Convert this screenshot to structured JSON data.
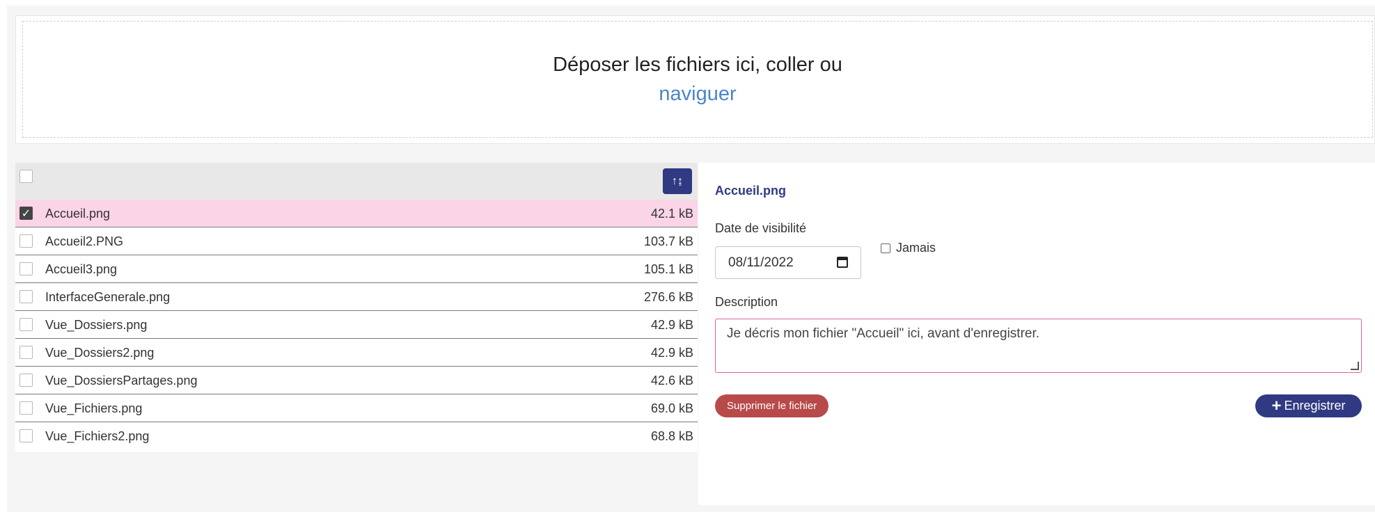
{
  "dropzone": {
    "text": "Déposer les fichiers ici, coller ou",
    "browse_link": "naviguer"
  },
  "file_list": {
    "sort_icon": "sort-ascending-icon",
    "files": [
      {
        "name": "Accueil.png",
        "size": "42.1 kB",
        "checked": true
      },
      {
        "name": "Accueil2.PNG",
        "size": "103.7 kB",
        "checked": false
      },
      {
        "name": "Accueil3.png",
        "size": "105.1 kB",
        "checked": false
      },
      {
        "name": "InterfaceGenerale.png",
        "size": "276.6 kB",
        "checked": false
      },
      {
        "name": "Vue_Dossiers.png",
        "size": "42.9 kB",
        "checked": false
      },
      {
        "name": "Vue_Dossiers2.png",
        "size": "42.9 kB",
        "checked": false
      },
      {
        "name": "Vue_DossiersPartages.png",
        "size": "42.6 kB",
        "checked": false
      },
      {
        "name": "Vue_Fichiers.png",
        "size": "69.0 kB",
        "checked": false
      },
      {
        "name": "Vue_Fichiers2.png",
        "size": "68.8 kB",
        "checked": false
      }
    ]
  },
  "details": {
    "title": "Accueil.png",
    "visibility_label": "Date de visibilité",
    "visibility_date": "08/11/2022",
    "never_label": "Jamais",
    "description_label": "Description",
    "description_value": "Je décris mon fichier \"Accueil\" ici, avant d'enregistrer.",
    "delete_label": "Supprimer le fichier",
    "save_label": "Enregistrer"
  },
  "colors": {
    "primary": "#303a82",
    "danger": "#b84a4a",
    "selected_row": "#fbd4e8",
    "focus_border": "#e05fa2",
    "link": "#4a86c9"
  }
}
